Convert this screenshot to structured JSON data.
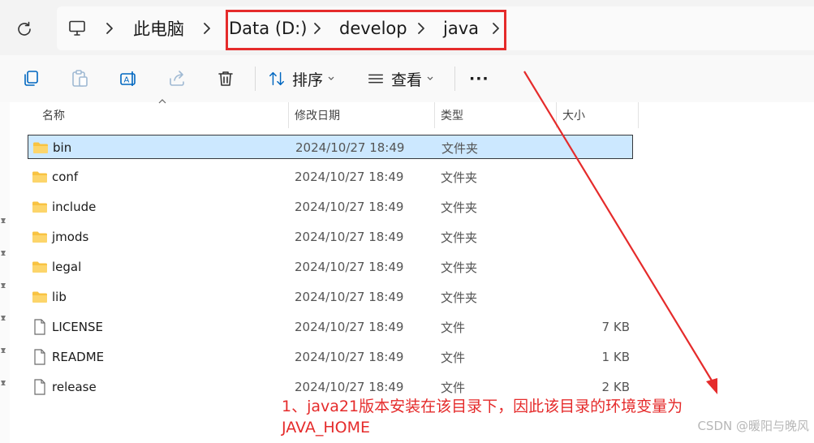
{
  "breadcrumb": {
    "items": [
      "此电脑",
      "Data (D:)",
      "develop",
      "java"
    ]
  },
  "toolbar": {
    "sort_label": "排序",
    "view_label": "查看",
    "more_label": "···"
  },
  "columns": {
    "name": "名称",
    "date": "修改日期",
    "type": "类型",
    "size": "大小"
  },
  "files": [
    {
      "name": "bin",
      "date": "2024/10/27 18:49",
      "type": "文件夹",
      "size": "",
      "kind": "folder",
      "selected": true
    },
    {
      "name": "conf",
      "date": "2024/10/27 18:49",
      "type": "文件夹",
      "size": "",
      "kind": "folder"
    },
    {
      "name": "include",
      "date": "2024/10/27 18:49",
      "type": "文件夹",
      "size": "",
      "kind": "folder"
    },
    {
      "name": "jmods",
      "date": "2024/10/27 18:49",
      "type": "文件夹",
      "size": "",
      "kind": "folder"
    },
    {
      "name": "legal",
      "date": "2024/10/27 18:49",
      "type": "文件夹",
      "size": "",
      "kind": "folder"
    },
    {
      "name": "lib",
      "date": "2024/10/27 18:49",
      "type": "文件夹",
      "size": "",
      "kind": "folder"
    },
    {
      "name": "LICENSE",
      "date": "2024/10/27 18:49",
      "type": "文件",
      "size": "7 KB",
      "kind": "file"
    },
    {
      "name": "README",
      "date": "2024/10/27 18:49",
      "type": "文件",
      "size": "1 KB",
      "kind": "file"
    },
    {
      "name": "release",
      "date": "2024/10/27 18:49",
      "type": "文件",
      "size": "2 KB",
      "kind": "file"
    }
  ],
  "annotation": {
    "line1": "1、java21版本安装在该目录下，因此该目录的环境变量为",
    "line2": "JAVA_HOME"
  },
  "watermark": "CSDN @暖阳与晚风",
  "colors": {
    "highlight": "#e52b2b",
    "selection": "#cce8ff",
    "folder": "#f8c342",
    "accent": "#0067c0"
  }
}
